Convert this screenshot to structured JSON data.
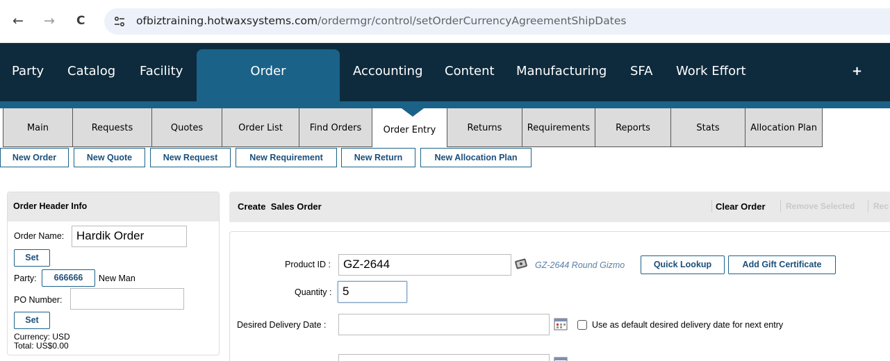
{
  "browser": {
    "back_icon": "←",
    "forward_icon": "→",
    "reload_icon": "C",
    "url_domain": "ofbiztraining.hotwaxsystems.com",
    "url_path": "/ordermgr/control/setOrderCurrencyAgreementShipDates"
  },
  "main_nav": {
    "items": [
      "Party",
      "Catalog",
      "Facility",
      "Order",
      "Accounting",
      "Content",
      "Manufacturing",
      "SFA",
      "Work Effort",
      "+"
    ],
    "active": "Order"
  },
  "sub_tabs": {
    "items": [
      "Main",
      "Requests",
      "Quotes",
      "Order List",
      "Find Orders",
      "Order Entry",
      "Returns",
      "Requirements",
      "Reports",
      "Stats",
      "Allocation Plan"
    ],
    "active": "Order Entry"
  },
  "actions": [
    "New Order",
    "New Quote",
    "New Request",
    "New Requirement",
    "New Return",
    "New Allocation Plan"
  ],
  "order_header": {
    "title": "Order Header Info",
    "order_name_label": "Order Name:",
    "order_name_value": "Hardik Order",
    "set_label": "Set",
    "party_label": "Party:",
    "party_id": "666666",
    "party_name": "New Man",
    "po_label": "PO Number:",
    "po_value": "",
    "set2_label": "Set",
    "currency": "Currency: USD",
    "total": "Total: US$0.00"
  },
  "create_order": {
    "title": "Create  Sales Order",
    "clear_order": "Clear Order",
    "remove_selected": "Remove Selected",
    "truncated_link": "Rec",
    "product_id_label": "Product ID :",
    "product_id_value": "GZ-2644",
    "product_desc": "GZ-2644 Round Gizmo",
    "quick_lookup": "Quick Lookup",
    "add_gift_cert": "Add Gift Certificate",
    "quantity_label": "Quantity :",
    "quantity_value": "5",
    "desired_date_label": "Desired Delivery Date :",
    "desired_date_value": "",
    "default_date_label": "Use as default desired delivery date for next entry"
  },
  "colors": {
    "nav_bg": "#0e2b3d",
    "nav_active": "#1b6288",
    "button_text": "#1b4f7a"
  }
}
